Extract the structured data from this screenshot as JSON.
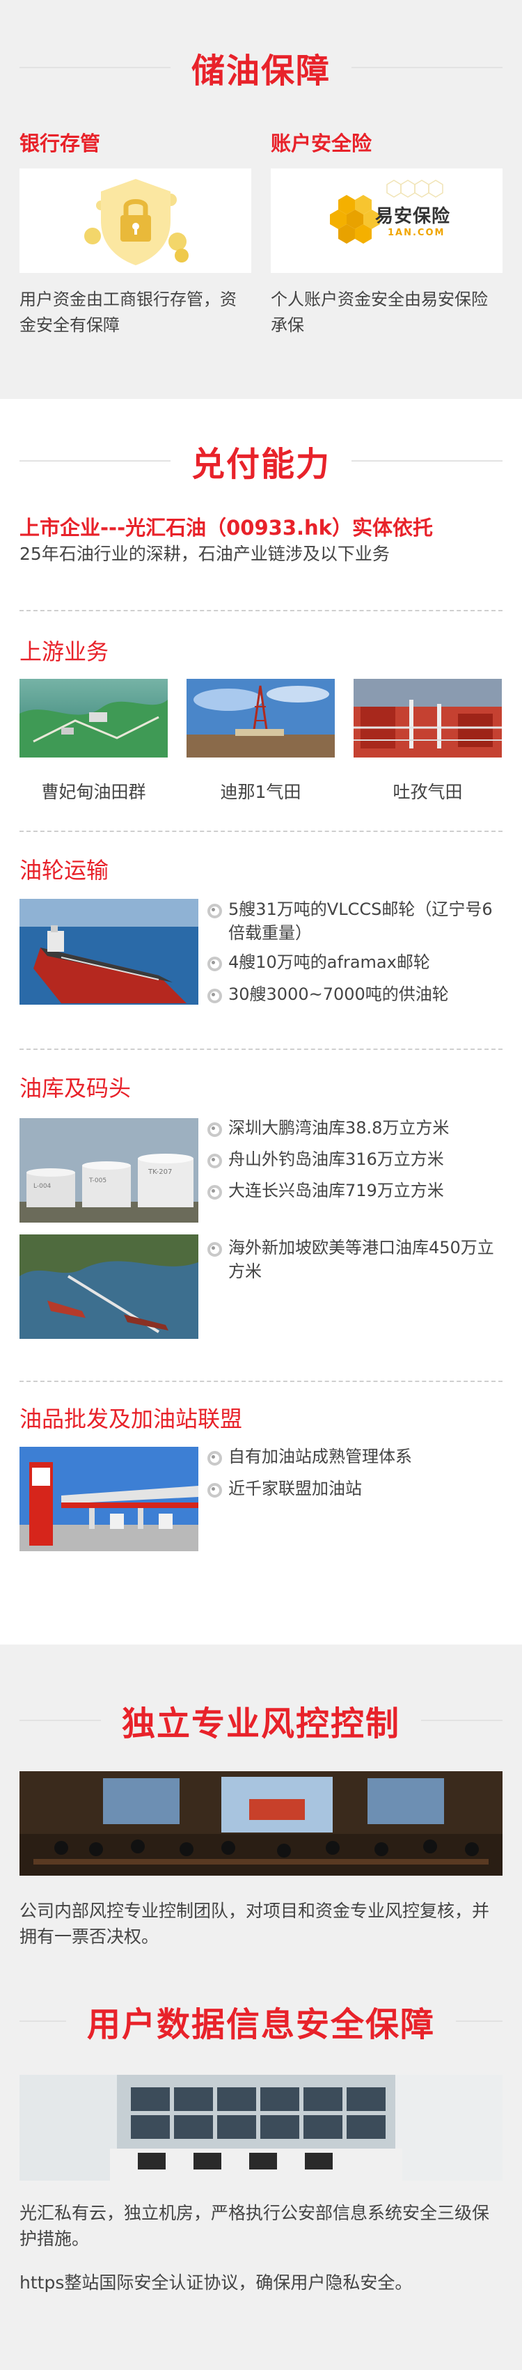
{
  "storage": {
    "title": "储油保障",
    "cards": [
      {
        "heading": "银行存管",
        "icon": "lock-shield-icon",
        "desc": "用户资金由工商银行存管，资金安全有保障"
      },
      {
        "heading": "账户安全险",
        "icon": "yian-logo",
        "logo_cn": "易安保险",
        "logo_en": "1AN.COM",
        "desc": "个人账户资金安全由易安保险承保"
      }
    ]
  },
  "payment": {
    "title": "兑付能力",
    "highlight": "上市企业---光汇石油（00933.hk）实体依托",
    "intro": "25年石油行业的深耕，石油产业链涉及以下业务",
    "upstream": {
      "title": "上游业务",
      "items": [
        {
          "caption": "曹妃甸油田群"
        },
        {
          "caption": "迪那1气田"
        },
        {
          "caption": "吐孜气田"
        }
      ]
    },
    "shipping": {
      "title": "油轮运输",
      "bullets": [
        "5艘31万吨的VLCCS邮轮（辽宁号6倍载重量）",
        "4艘10万吨的aframax邮轮",
        "30艘3000~7000吨的供油轮"
      ]
    },
    "depot": {
      "title": "油库及码头",
      "tank_labels": [
        "L-004",
        "T-005",
        "TK-207"
      ],
      "bullets_a": [
        "深圳大鹏湾油库38.8万立方米",
        "舟山外钓岛油库316万立方米",
        "大连长兴岛油库719万立方米"
      ],
      "bullets_b": [
        "海外新加坡欧美等港口油库450万立方米"
      ]
    },
    "wholesale": {
      "title": "油品批发及加油站联盟",
      "bullets": [
        "自有加油站成熟管理体系",
        "近千家联盟加油站"
      ]
    }
  },
  "risk": {
    "title": "独立专业风控控制",
    "desc": "公司内部风控专业控制团队，对项目和资金专业风控复核，并拥有一票否决权。"
  },
  "data_security": {
    "title": "用户数据信息安全保障",
    "desc1": "光汇私有云，独立机房，严格执行公安部信息系统安全三级保护措施。",
    "desc2": "https整站国际安全认证协议，确保用户隐私安全。"
  },
  "colors": {
    "accent": "#e8222a",
    "gray_bg": "#f0f0f0"
  }
}
